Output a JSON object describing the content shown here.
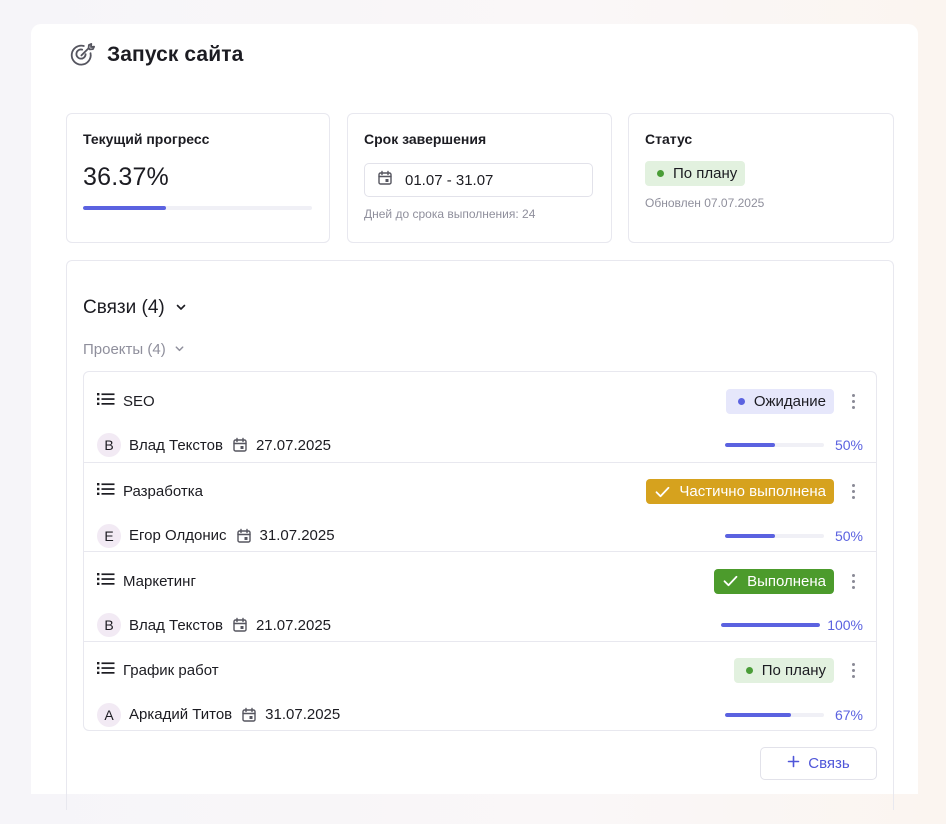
{
  "page": {
    "title": "Запуск сайта",
    "title_icon": "target-icon"
  },
  "cards": {
    "progress": {
      "title": "Текущий прогресс",
      "value": "36.37%",
      "fraction": 0.3637
    },
    "deadline": {
      "title": "Срок завершения",
      "date_range": "01.07 - 31.07",
      "hint": "Дней до срока выполнения: 24"
    },
    "status": {
      "title": "Статус",
      "badge": "По плану",
      "updated": "Обновлен 07.07.2025"
    }
  },
  "links": {
    "title": "Связи (4)",
    "group": "Проекты (4)",
    "add_label": "Связь",
    "items": [
      {
        "title": "SEO",
        "badge": "Ожидание",
        "badge_kind": "wait",
        "avatar": "В",
        "person": "Влад Текстов",
        "due": "27.07.2025",
        "progress": "50%",
        "fraction": 0.5
      },
      {
        "title": "Разработка",
        "badge": "Частично выполнена",
        "badge_kind": "partial",
        "avatar": "Е",
        "person": "Егор Олдонис",
        "due": "31.07.2025",
        "progress": "50%",
        "fraction": 0.5
      },
      {
        "title": "Маркетинг",
        "badge": "Выполнена",
        "badge_kind": "done",
        "avatar": "В",
        "person": "Влад Текстов",
        "due": "21.07.2025",
        "progress": "100%",
        "fraction": 1.0
      },
      {
        "title": "График работ",
        "badge": "По плану",
        "badge_kind": "plan",
        "avatar": "А",
        "person": "Аркадий Титов",
        "due": "31.07.2025",
        "progress": "67%",
        "fraction": 0.67
      }
    ]
  },
  "colors": {
    "accent": "#5b62e0",
    "plan": "#4a9d37",
    "partial": "#d6a21e",
    "done": "#4c9b2c",
    "wait_bg": "#e6e7fb"
  }
}
